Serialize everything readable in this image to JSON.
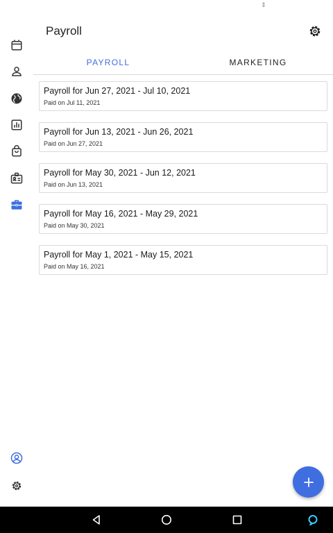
{
  "app": {
    "title": "Payroll"
  },
  "status_bar": {
    "glyph": "⇕"
  },
  "rail": {
    "items": [
      {
        "name": "calendar-icon",
        "active": false
      },
      {
        "name": "person-icon",
        "active": false
      },
      {
        "name": "globe-icon",
        "active": false
      },
      {
        "name": "bar-chart-icon",
        "active": false
      },
      {
        "name": "shopping-bag-icon",
        "active": false
      },
      {
        "name": "id-card-icon",
        "active": false
      },
      {
        "name": "briefcase-icon",
        "active": true
      }
    ],
    "bottom": [
      {
        "name": "account-circle-icon"
      },
      {
        "name": "gear-icon"
      }
    ]
  },
  "header": {
    "settings_icon": "gear-icon"
  },
  "tabs": [
    {
      "label": "PAYROLL",
      "active": true
    },
    {
      "label": "MARKETING",
      "active": false
    }
  ],
  "payrolls": [
    {
      "title": "Payroll for Jun 27, 2021 - Jul 10, 2021",
      "paid": "Paid on Jul 11, 2021"
    },
    {
      "title": "Payroll for Jun 13, 2021 - Jun 26, 2021",
      "paid": "Paid on Jun 27, 2021"
    },
    {
      "title": "Payroll for May 30, 2021 - Jun 12, 2021",
      "paid": "Paid on Jun 13, 2021"
    },
    {
      "title": "Payroll for May 16, 2021 - May 29, 2021",
      "paid": "Paid on May 30, 2021"
    },
    {
      "title": "Payroll for May 1, 2021 - May 15, 2021",
      "paid": "Paid on May 16, 2021"
    }
  ],
  "fab": {
    "icon": "plus-icon"
  },
  "navbar": {
    "buttons": [
      "back-icon",
      "home-icon",
      "recents-icon",
      "assistant-icon"
    ]
  },
  "colors": {
    "accent": "#3f6ee0",
    "icon": "#333333",
    "assistant": "#33ccff"
  }
}
